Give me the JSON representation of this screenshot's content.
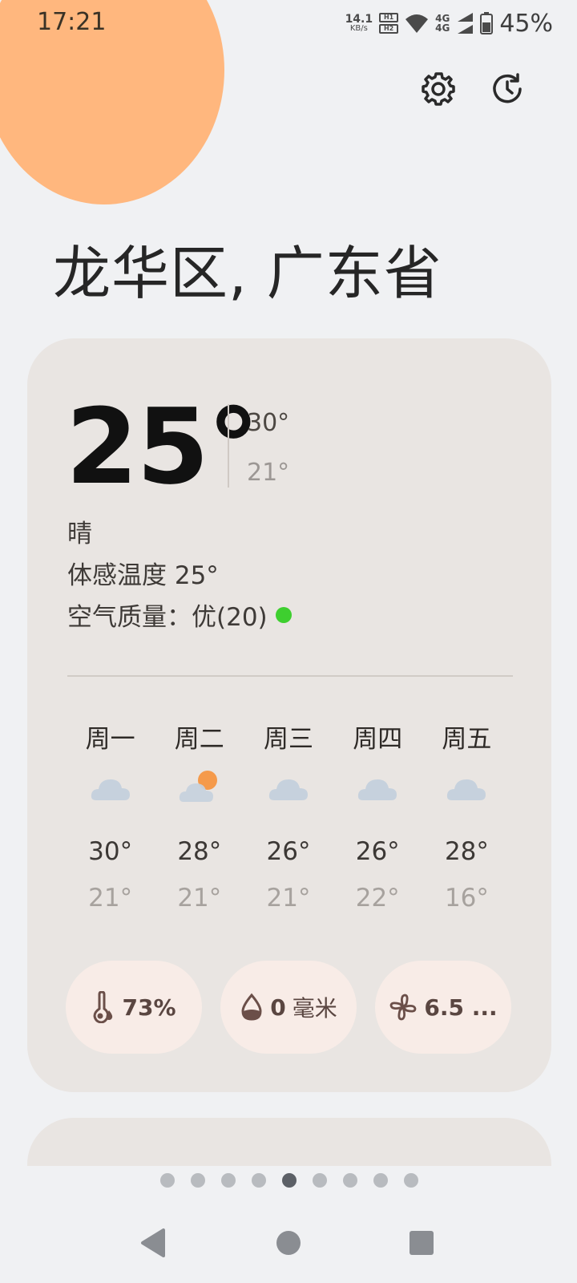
{
  "status_bar": {
    "time": "17:21",
    "net_speed_value": "14.1",
    "net_speed_unit": "KB/s",
    "sim1": "H1",
    "sim2": "H2",
    "net_top": "4G",
    "net_bottom": "4G",
    "battery": "45%"
  },
  "header": {
    "settings_icon": "gear-icon",
    "history_icon": "history-icon"
  },
  "location": "龙华区, 广东省",
  "current": {
    "temp": "25°",
    "high": "30°",
    "low": "21°",
    "condition": "晴",
    "feels_like": "体感温度 25°",
    "aqi_label": "空气质量：",
    "aqi_value": "优(20)",
    "aqi_color": "#3ecf2f"
  },
  "forecast": [
    {
      "day": "周一",
      "icon": "cloud-icon",
      "high": "30°",
      "low": "21°"
    },
    {
      "day": "周二",
      "icon": "partly-sunny-icon",
      "high": "28°",
      "low": "21°"
    },
    {
      "day": "周三",
      "icon": "cloud-icon",
      "high": "26°",
      "low": "21°"
    },
    {
      "day": "周四",
      "icon": "cloud-icon",
      "high": "26°",
      "low": "22°"
    },
    {
      "day": "周五",
      "icon": "cloud-icon",
      "high": "28°",
      "low": "16°"
    }
  ],
  "chips": {
    "humidity": "73%",
    "precipitation_value": "0",
    "precipitation_unit": "毫米",
    "wind": "6.5 ..."
  },
  "pager": {
    "count": 9,
    "active": 4
  },
  "colors": {
    "background": "#f0f1f3",
    "card": "#e9e5e2",
    "sun_blob": "#ffb77e",
    "chip": "#f8ece7",
    "cloud": "#c6d1dd",
    "sun": "#f59a4b"
  }
}
